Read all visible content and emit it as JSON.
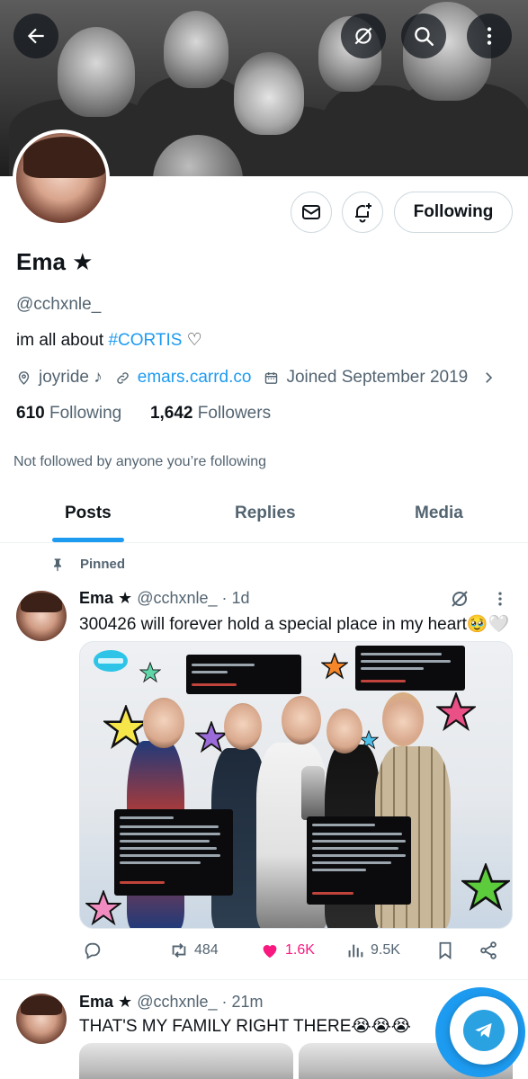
{
  "profile": {
    "name": "Ema ★",
    "handle": "@cchxnle_",
    "bio_text": "im all about ",
    "bio_tag": "#CORTIS",
    "bio_heart": "♡",
    "location": "joyride ♪",
    "website": "emars.carrd.co",
    "joined": "Joined September 2019",
    "following_count": "610",
    "following_label": "Following",
    "followers_count": "1,642",
    "followers_label": "Followers",
    "not_followed": "Not followed by anyone you’re following",
    "follow_button": "Following"
  },
  "tabs": [
    {
      "label": "Posts",
      "active": true
    },
    {
      "label": "Replies",
      "active": false
    },
    {
      "label": "Media",
      "active": false
    }
  ],
  "posts": [
    {
      "pinned_label": "Pinned",
      "name": "Ema ★",
      "handle": "@cchxnle_",
      "time": "· 1d",
      "text": "300426 will forever hold a special place in my heart🥹🤍",
      "retweets": "484",
      "likes": "1.6K",
      "views": "9.5K"
    },
    {
      "name": "Ema ★",
      "handle": "@cchxnle_",
      "time": "· 21m",
      "text": "THAT'S MY FAMILY RIGHT THERE😭😭😭"
    }
  ],
  "icons": {
    "back": "arrow-left-icon",
    "grok": "slash-circle-icon",
    "search": "search-icon",
    "more": "more-vertical-icon",
    "message": "envelope-icon",
    "notify": "bell-plus-icon",
    "location": "location-pin-icon",
    "link": "link-icon",
    "calendar": "calendar-icon",
    "pin": "pin-icon",
    "reply": "comment-icon",
    "retweet": "retweet-icon",
    "like": "heart-icon",
    "views": "views-bar-icon",
    "bookmark": "bookmark-icon",
    "share": "share-icon",
    "telegram": "telegram-icon"
  },
  "colors": {
    "accent": "#1d9bf0",
    "like": "#f91880",
    "secondary_text": "#536471",
    "primary_text": "#0f1419"
  }
}
